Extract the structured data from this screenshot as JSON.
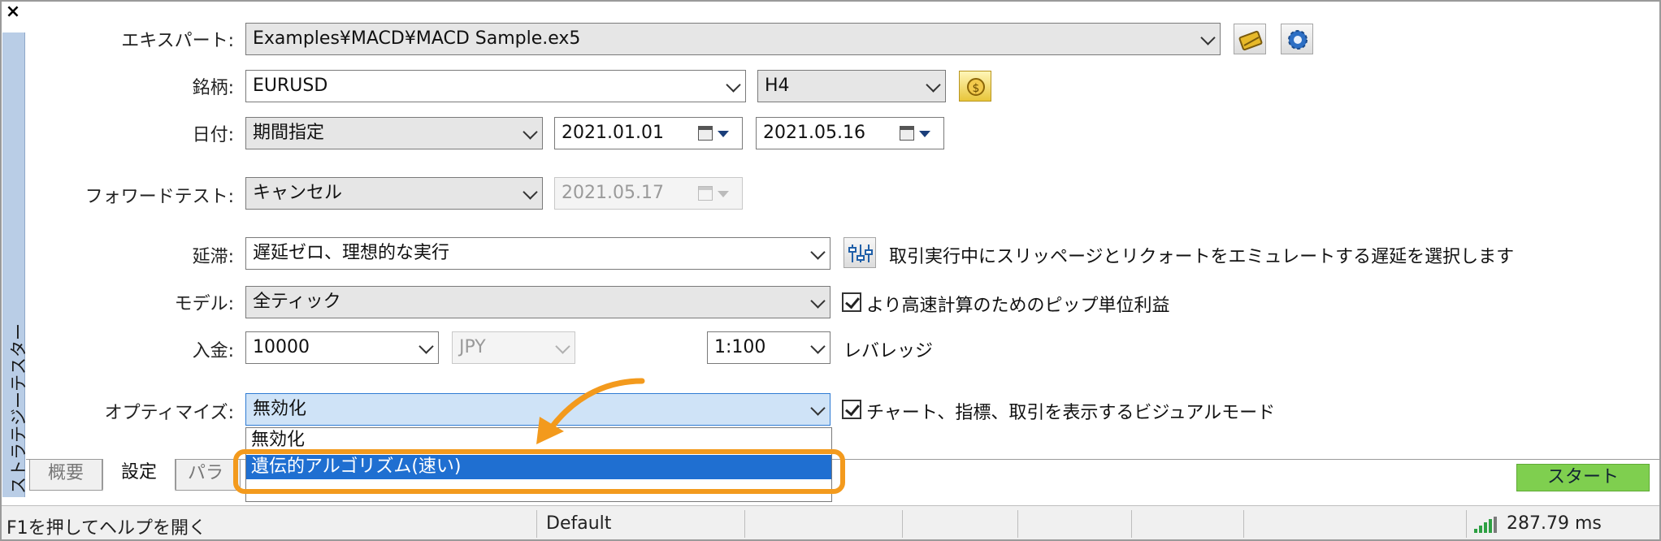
{
  "window": {
    "close_label": "×",
    "side_tab_label": "ストラテジーテスター"
  },
  "form": {
    "expert": {
      "label": "エキスパート:",
      "value": "Examples¥MACD¥MACD Sample.ex5"
    },
    "symbol": {
      "label": "銘柄:",
      "value": "EURUSD",
      "timeframe": "H4"
    },
    "date": {
      "label": "日付:",
      "mode": "期間指定",
      "from": "2021.01.01",
      "to": "2021.05.16"
    },
    "forward": {
      "label": "フォワードテスト:",
      "mode": "キャンセル",
      "date": "2021.05.17"
    },
    "delay": {
      "label": "延滞:",
      "value": "遅延ゼロ、理想的な実行",
      "description": "取引実行中にスリッページとリクォートをエミュレートする遅延を選択します"
    },
    "model": {
      "label": "モデル:",
      "value": "全ティック",
      "pips_checkbox_label": "より高速計算のためのピップ単位利益",
      "pips_checked": true
    },
    "deposit": {
      "label": "入金:",
      "amount": "10000",
      "currency": "JPY",
      "leverage": "1:100",
      "leverage_label": "レバレッジ"
    },
    "optimize": {
      "label": "オプティマイズ:",
      "value": "無効化",
      "visual_checkbox_label": "チャート、指標、取引を表示するビジュアルモード",
      "visual_checked": true,
      "options": [
        "無効化",
        "遺伝的アルゴリズム(速い)"
      ]
    }
  },
  "tabs": [
    "概要",
    "設定",
    "パラ"
  ],
  "start_label": "スタート",
  "statusbar": {
    "help": "F1を押してヘルプを開く",
    "profile": "Default",
    "ping": "287.79 ms"
  },
  "colors": {
    "side_tab": "#b9cde6",
    "start": "#7fcf4f",
    "highlight": "#f39a1d",
    "selection": "#1f6fd1"
  },
  "icons": [
    "expert-properties-icon",
    "settings-gear-icon",
    "symbol-icon",
    "delay-settings-icon",
    "calendar-icon",
    "signal-bars-icon"
  ]
}
